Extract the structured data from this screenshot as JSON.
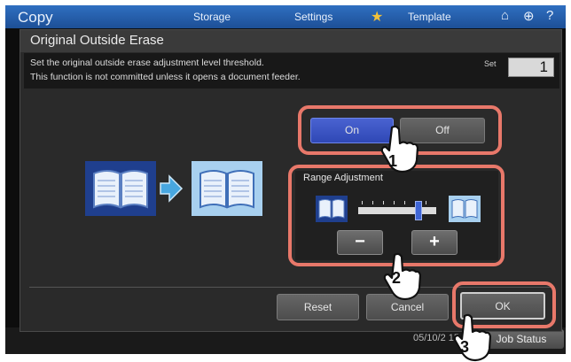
{
  "app": {
    "title": "Copy",
    "tabs": [
      "Storage",
      "Settings",
      "Template"
    ],
    "date_time": "05/10/2 15",
    "job_status_label": "Job Status"
  },
  "dialog": {
    "title": "Original Outside Erase",
    "info_line1": "Set the original outside erase adjustment level threshold.",
    "info_line2": "This function is not committed unless it opens a document feeder.",
    "set_label": "Set",
    "set_value": "1"
  },
  "toggle": {
    "on_label": "On",
    "off_label": "Off",
    "selected": "On"
  },
  "range": {
    "title": "Range Adjustment",
    "minus_label": "−",
    "plus_label": "+",
    "level": 0.8
  },
  "footer": {
    "reset_label": "Reset",
    "cancel_label": "Cancel",
    "ok_label": "OK"
  },
  "annotations": {
    "step1": "1",
    "step2": "2",
    "step3": "3"
  },
  "colors": {
    "accent_blue": "#3f66d6",
    "highlight_ring": "#e8786a",
    "topbar": "#2a62b3"
  },
  "icons": [
    "book-icon",
    "arrow-right-icon",
    "home-icon",
    "globe-icon",
    "help-icon",
    "star-icon",
    "hand-pointer-icon"
  ]
}
